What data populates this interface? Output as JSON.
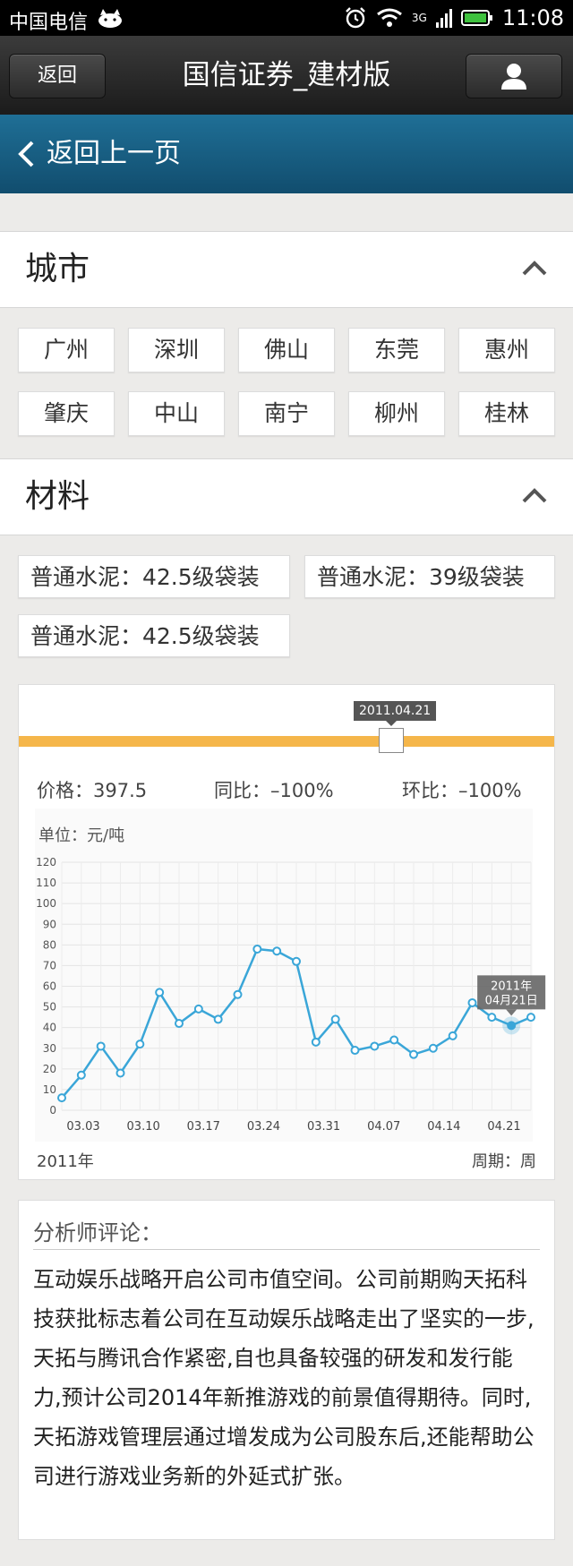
{
  "status_bar": {
    "carrier": "中国电信",
    "network": "3G",
    "time": "11:08"
  },
  "nav": {
    "back_label": "返回",
    "title": "国信证券_建材版"
  },
  "subnav": {
    "back_label": "返回上一页"
  },
  "city_section": {
    "title": "城市",
    "cities": [
      "广州",
      "深圳",
      "佛山",
      "东莞",
      "惠州",
      "肇庆",
      "中山",
      "南宁",
      "柳州",
      "桂林"
    ]
  },
  "material_section": {
    "title": "材料",
    "tags": [
      "普通水泥：42.5级袋装",
      "普通水泥：39级袋装",
      "普通水泥：42.5级袋装"
    ]
  },
  "chart_card": {
    "slider_date": "2011.04.21",
    "price": "价格：397.5",
    "yoy": "同比：–100%",
    "mom": "环比：–100%",
    "unit": "单位：元/吨",
    "year": "2011年",
    "period": "周期：周"
  },
  "chart_data": {
    "type": "line",
    "title": "",
    "xlabel": "",
    "ylabel": "单位：元/吨",
    "ylim": [
      0,
      120
    ],
    "y_ticks": [
      0,
      10,
      20,
      30,
      40,
      50,
      60,
      70,
      80,
      90,
      100,
      110,
      120
    ],
    "x_tick_labels": [
      "03.03",
      "03.10",
      "03.17",
      "03.24",
      "03.31",
      "04.07",
      "04.14",
      "04.21"
    ],
    "grid": true,
    "color": "#3aa6d8",
    "values": [
      6,
      17,
      31,
      18,
      32,
      57,
      42,
      49,
      44,
      56,
      78,
      77,
      72,
      33,
      44,
      29,
      31,
      34,
      27,
      30,
      36,
      52,
      45,
      41,
      45
    ],
    "tooltip": {
      "line1": "2011年",
      "line2": "04月21日"
    }
  },
  "analyst": {
    "title": "分析师评论：",
    "body": "互动娱乐战略开启公司市值空间。公司前期购天拓科技获批标志着公司在互动娱乐战略走出了坚实的一步,天拓与腾讯合作紧密,自也具备较强的研发和发行能力,预计公司2014年新推游戏的前景值得期待。同时,天拓游戏管理层通过增发成为公司股东后,还能帮助公司进行游戏业务新的外延式扩张。"
  }
}
